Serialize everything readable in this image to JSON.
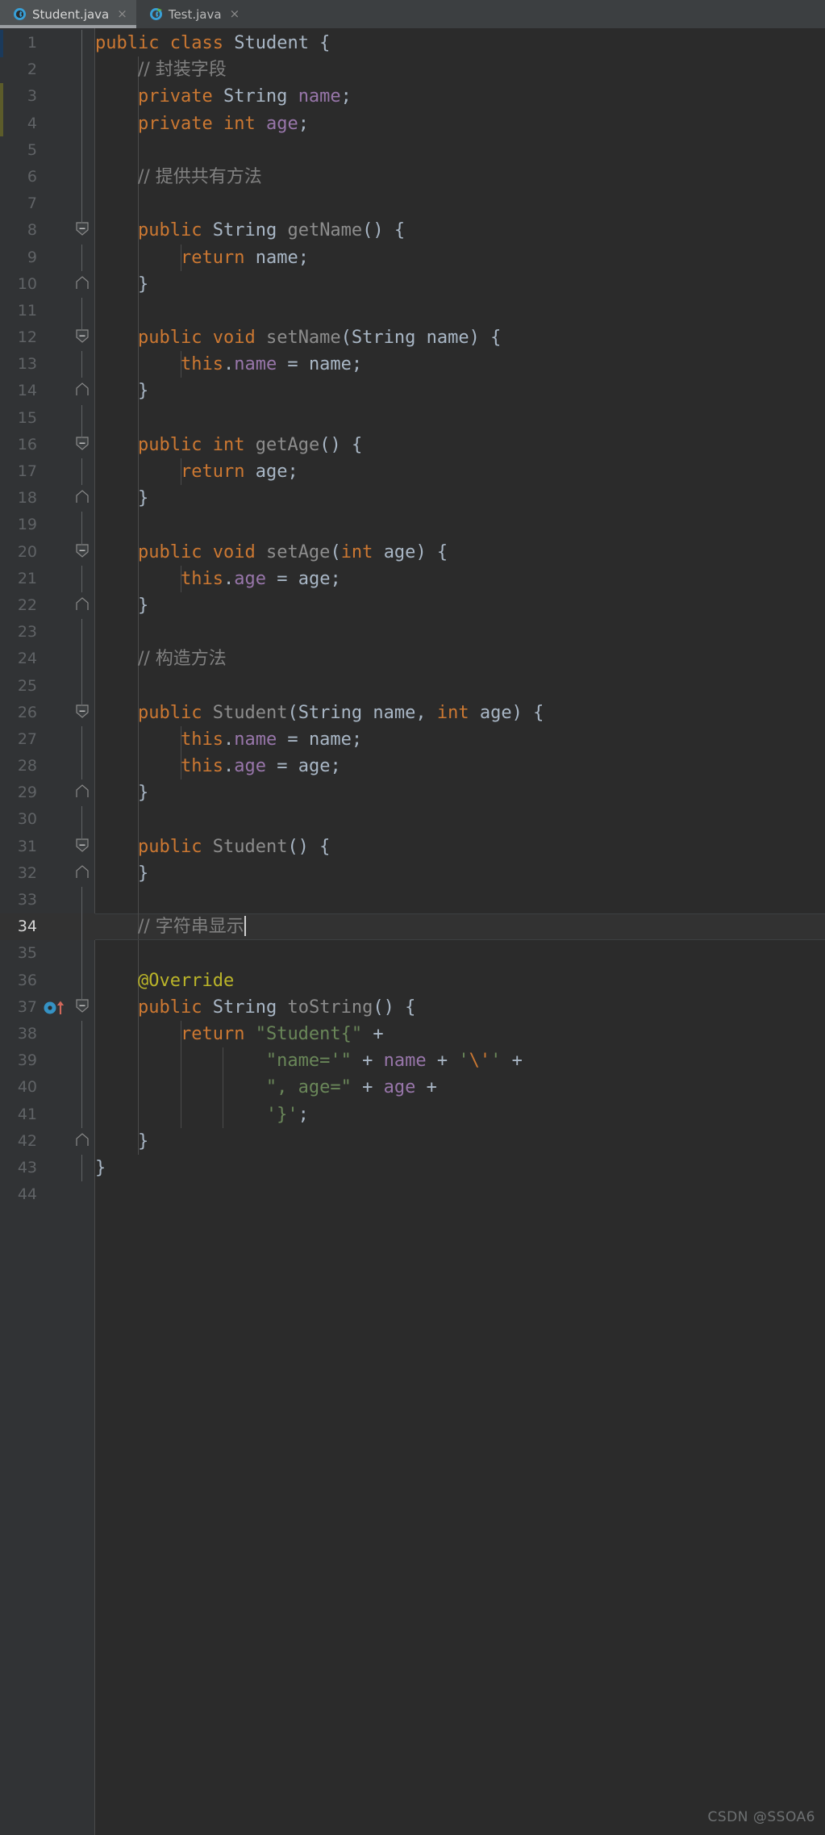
{
  "window": {
    "theme_background": "#2b2b2b",
    "gutter_background": "#313335",
    "tabbar_background": "#3c3f41"
  },
  "tabs": [
    {
      "label": "Student.java",
      "icon": "java-class-icon",
      "close_label": "×",
      "active": true
    },
    {
      "label": "Test.java",
      "icon": "java-runnable-class-icon",
      "close_label": "×",
      "active": false
    }
  ],
  "editor": {
    "caret_line": 34,
    "total_lines": 44,
    "language": "Java",
    "colors": {
      "keyword": "#cc7832",
      "string": "#6a8759",
      "field": "#9876aa",
      "method": "#8d8d8d",
      "comment": "#808080",
      "annotation": "#bbb529",
      "default_text": "#a9b7c6"
    },
    "gutter_icons": [
      {
        "line": 37,
        "name": "overridden-method-icon"
      }
    ],
    "vcs_markers": [
      {
        "line": 1,
        "color": "#1a3a5c"
      },
      {
        "line": 3,
        "color": "#5c5c2a"
      },
      {
        "line": 4,
        "color": "#5c5c2a"
      }
    ],
    "lines": [
      {
        "n": 1,
        "text": "public class Student {"
      },
      {
        "n": 2,
        "text": "    // 封装字段"
      },
      {
        "n": 3,
        "text": "    private String name;"
      },
      {
        "n": 4,
        "text": "    private int age;"
      },
      {
        "n": 5,
        "text": ""
      },
      {
        "n": 6,
        "text": "    // 提供共有方法"
      },
      {
        "n": 7,
        "text": ""
      },
      {
        "n": 8,
        "text": "    public String getName() {"
      },
      {
        "n": 9,
        "text": "        return name;"
      },
      {
        "n": 10,
        "text": "    }"
      },
      {
        "n": 11,
        "text": ""
      },
      {
        "n": 12,
        "text": "    public void setName(String name) {"
      },
      {
        "n": 13,
        "text": "        this.name = name;"
      },
      {
        "n": 14,
        "text": "    }"
      },
      {
        "n": 15,
        "text": ""
      },
      {
        "n": 16,
        "text": "    public int getAge() {"
      },
      {
        "n": 17,
        "text": "        return age;"
      },
      {
        "n": 18,
        "text": "    }"
      },
      {
        "n": 19,
        "text": ""
      },
      {
        "n": 20,
        "text": "    public void setAge(int age) {"
      },
      {
        "n": 21,
        "text": "        this.age = age;"
      },
      {
        "n": 22,
        "text": "    }"
      },
      {
        "n": 23,
        "text": ""
      },
      {
        "n": 24,
        "text": "    // 构造方法"
      },
      {
        "n": 25,
        "text": ""
      },
      {
        "n": 26,
        "text": "    public Student(String name, int age) {"
      },
      {
        "n": 27,
        "text": "        this.name = name;"
      },
      {
        "n": 28,
        "text": "        this.age = age;"
      },
      {
        "n": 29,
        "text": "    }"
      },
      {
        "n": 30,
        "text": ""
      },
      {
        "n": 31,
        "text": "    public Student() {"
      },
      {
        "n": 32,
        "text": "    }"
      },
      {
        "n": 33,
        "text": ""
      },
      {
        "n": 34,
        "text": "    // 字符串显示"
      },
      {
        "n": 35,
        "text": ""
      },
      {
        "n": 36,
        "text": "    @Override"
      },
      {
        "n": 37,
        "text": "    public String toString() {"
      },
      {
        "n": 38,
        "text": "        return \"Student{\" +"
      },
      {
        "n": 39,
        "text": "                \"name='\" + name + '\\'' +"
      },
      {
        "n": 40,
        "text": "                \", age=\" + age +"
      },
      {
        "n": 41,
        "text": "                '}';"
      },
      {
        "n": 42,
        "text": "    }"
      },
      {
        "n": 43,
        "text": "}"
      },
      {
        "n": 44,
        "text": ""
      }
    ]
  },
  "watermark": {
    "text": "CSDN @SSOA6"
  }
}
